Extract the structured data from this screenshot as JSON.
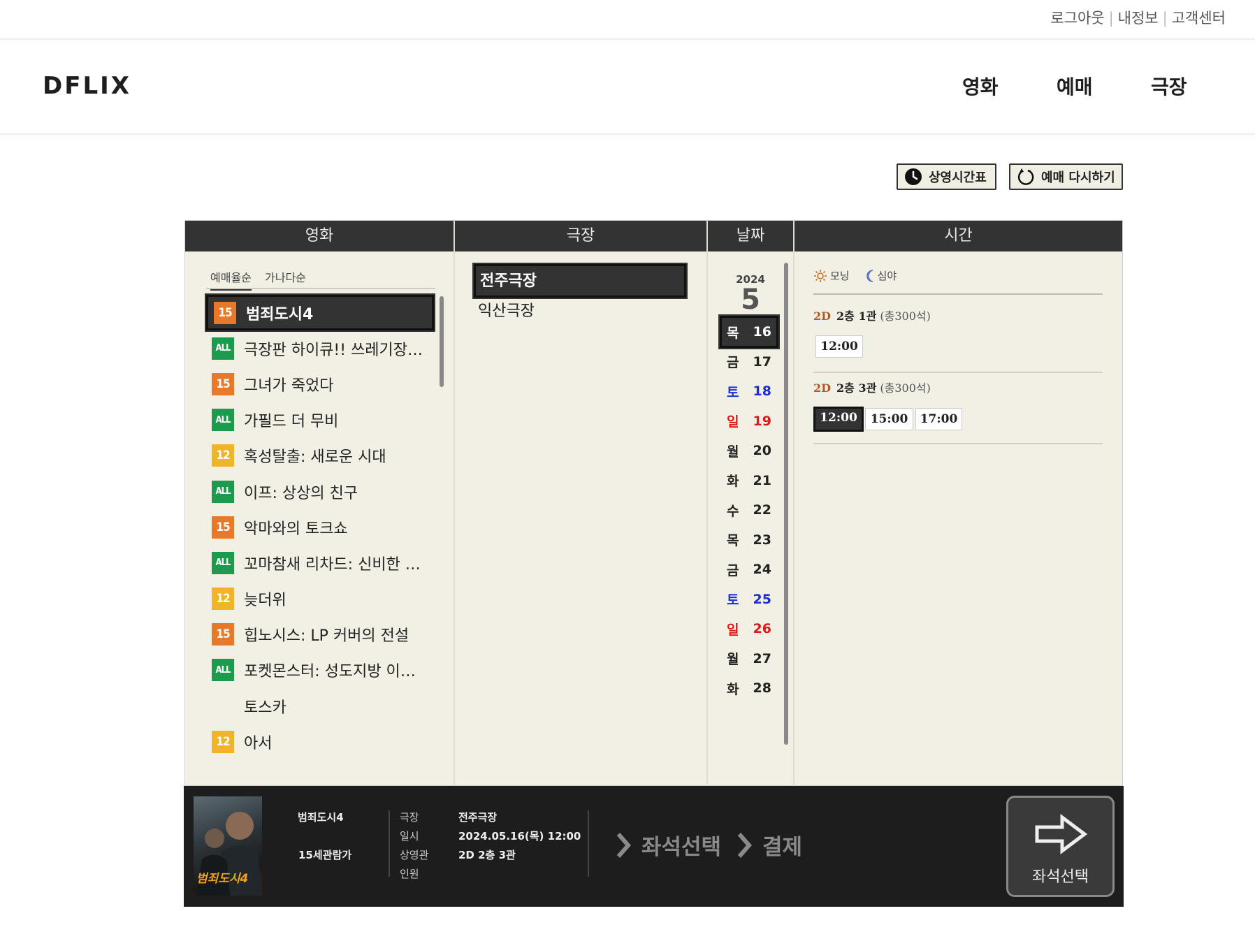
{
  "util_links": [
    "로그아웃",
    "내정보",
    "고객센터"
  ],
  "logo": "DFLIX",
  "nav": [
    "영화",
    "예매",
    "극장"
  ],
  "actions": {
    "schedule": "상영시간표",
    "reset": "예매 다시하기"
  },
  "columns": {
    "movie": "영화",
    "theater": "극장",
    "date": "날짜",
    "time": "시간"
  },
  "sort_tabs": [
    "예매율순",
    "가나다순"
  ],
  "movies": [
    {
      "rating": "15",
      "title": "범죄도시4",
      "selected": true
    },
    {
      "rating": "ALL",
      "title": "극장판 하이큐!! 쓰레기장의 결전"
    },
    {
      "rating": "15",
      "title": "그녀가 죽었다"
    },
    {
      "rating": "ALL",
      "title": "가필드 더 무비"
    },
    {
      "rating": "12",
      "title": "혹성탈출: 새로운 시대"
    },
    {
      "rating": "ALL",
      "title": "이프: 상상의 친구"
    },
    {
      "rating": "15",
      "title": "악마와의 토크쇼"
    },
    {
      "rating": "ALL",
      "title": "꼬마참새 리차드: 신비한 보석 찾기"
    },
    {
      "rating": "12",
      "title": "늦더위"
    },
    {
      "rating": "15",
      "title": "힙노시스: LP 커버의 전설"
    },
    {
      "rating": "ALL",
      "title": "포켓몬스터: 성도지방 이야기"
    },
    {
      "rating": "",
      "title": "토스카"
    },
    {
      "rating": "12",
      "title": "아서"
    }
  ],
  "theaters": [
    {
      "name": "전주극장",
      "selected": true
    },
    {
      "name": "익산극장"
    }
  ],
  "date": {
    "year": "2024",
    "month": "5",
    "days": [
      {
        "dow": "목",
        "day": "16",
        "type": "weekday",
        "selected": true
      },
      {
        "dow": "금",
        "day": "17",
        "type": "weekday"
      },
      {
        "dow": "토",
        "day": "18",
        "type": "sat"
      },
      {
        "dow": "일",
        "day": "19",
        "type": "sun"
      },
      {
        "dow": "월",
        "day": "20",
        "type": "weekday"
      },
      {
        "dow": "화",
        "day": "21",
        "type": "weekday"
      },
      {
        "dow": "수",
        "day": "22",
        "type": "weekday"
      },
      {
        "dow": "목",
        "day": "23",
        "type": "weekday"
      },
      {
        "dow": "금",
        "day": "24",
        "type": "weekday"
      },
      {
        "dow": "토",
        "day": "25",
        "type": "sat"
      },
      {
        "dow": "일",
        "day": "26",
        "type": "sun"
      },
      {
        "dow": "월",
        "day": "27",
        "type": "weekday"
      },
      {
        "dow": "화",
        "day": "28",
        "type": "weekday"
      }
    ]
  },
  "time_legend": {
    "morning": "모닝",
    "late": "심야"
  },
  "screens": [
    {
      "format": "2D",
      "name": "2층 1관",
      "capacity": "(총300석)",
      "times": [
        {
          "t": "12:00"
        }
      ]
    },
    {
      "format": "2D",
      "name": "2층 3관",
      "capacity": "(총300석)",
      "times": [
        {
          "t": "12:00",
          "selected": true
        },
        {
          "t": "15:00"
        },
        {
          "t": "17:00"
        }
      ]
    }
  ],
  "summary": {
    "poster_title": "범죄도시4",
    "movie_title": "범죄도시4",
    "age": "15세관람가",
    "labels": {
      "theater": "극장",
      "datetime": "일시",
      "screen": "상영관",
      "people": "인원"
    },
    "values": {
      "theater": "전주극장",
      "datetime": "2024.05.16(목) 12:00",
      "screen": "2D 2층 3관",
      "people": ""
    },
    "steps": [
      "좌석선택",
      "결제"
    ],
    "next_button": "좌석선택"
  },
  "colors": {
    "header_bg": "#333333",
    "panel_bg": "#f2f0e4",
    "rating_15": "#e8782a",
    "rating_all": "#1c9a4e",
    "rating_12": "#f0b429",
    "saturday": "#1a2fd6",
    "sunday": "#e01919",
    "format_2d": "#b8561f"
  }
}
